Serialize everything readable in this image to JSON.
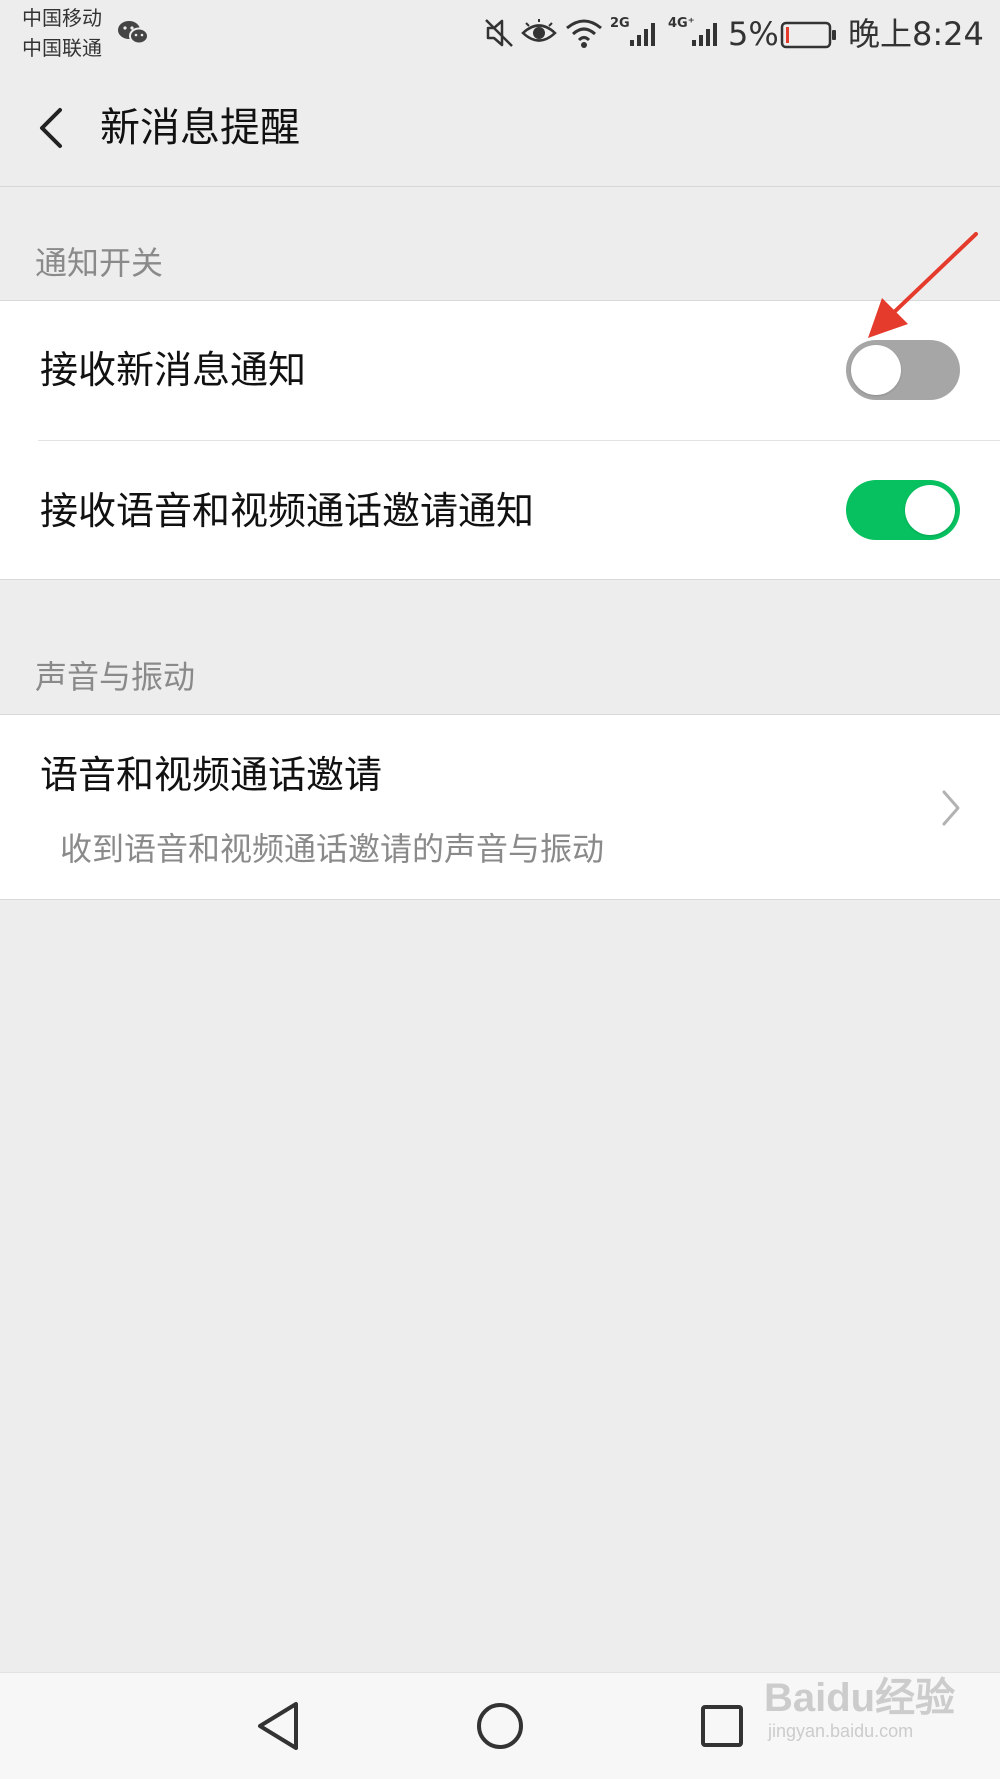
{
  "status_bar": {
    "carrier_1": "中国移动",
    "carrier_2": "中国联通",
    "battery_percent": "5%",
    "battery_level": 0.05,
    "network_2g": "2G",
    "network_4g": "4G⁺",
    "time": "晚上8:24",
    "icons": [
      "wechat-icon",
      "mute-icon",
      "eye-icon",
      "wifi-icon",
      "signal-icon",
      "battery-icon"
    ]
  },
  "header": {
    "title": "新消息提醒",
    "back_icon": "chevron-left-icon"
  },
  "sections": {
    "notification": {
      "label": "通知开关",
      "items": [
        {
          "label": "接收新消息通知",
          "enabled": false
        },
        {
          "label": "接收语音和视频通话邀请通知",
          "enabled": true
        }
      ]
    },
    "sound": {
      "label": "声音与振动",
      "items": [
        {
          "label": "语音和视频通话邀请",
          "sub_label": "收到语音和视频通话邀请的声音与振动"
        }
      ]
    }
  },
  "nav_bar": {
    "icons": [
      "back-triangle-icon",
      "home-circle-icon",
      "recents-square-icon"
    ]
  },
  "watermark": {
    "brand": "Baidu经验",
    "url": "jingyan.baidu.com"
  },
  "colors": {
    "background": "#ededed",
    "toggle_on": "#07c160",
    "toggle_off": "#a6a6a6",
    "arrow": "#e53b2c"
  }
}
